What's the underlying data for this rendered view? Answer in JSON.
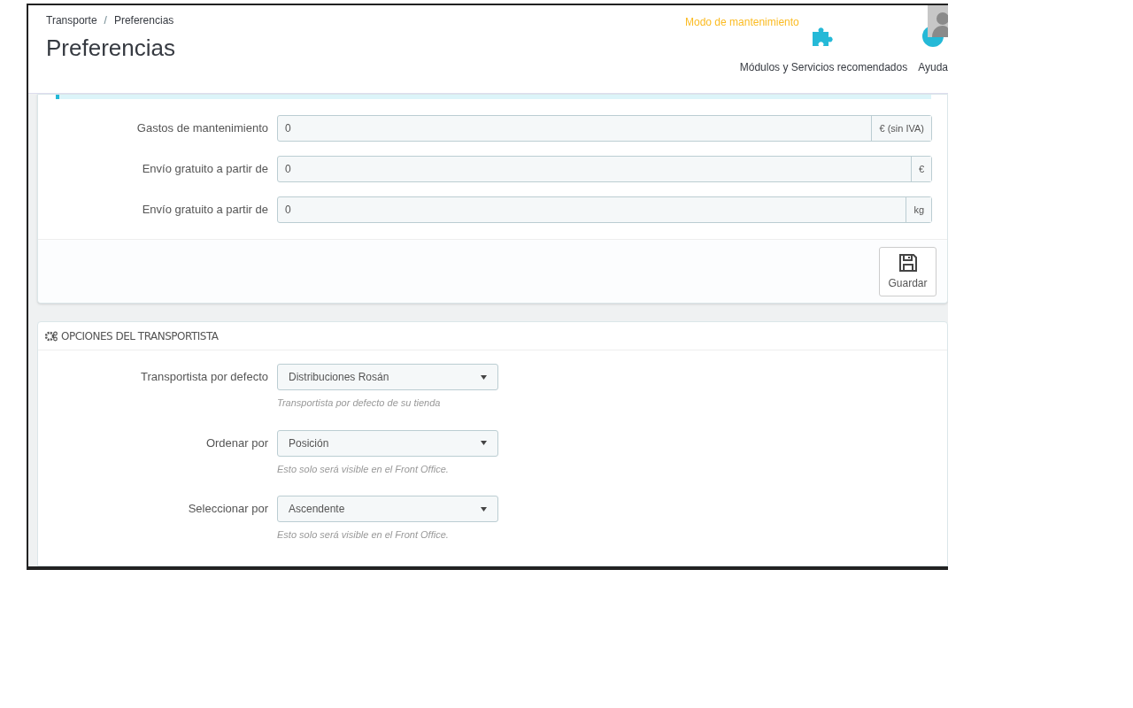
{
  "breadcrumb": [
    "Transporte",
    "Preferencias"
  ],
  "breadcrumb_separator": "/",
  "page_title": "Preferencias",
  "maintenance_link": "Modo de mantenimiento",
  "toolbar": [
    {
      "kind": "modules",
      "label": "Módulos y Servicios recomendados"
    },
    {
      "kind": "help",
      "label": "Ayuda"
    }
  ],
  "fees_panel": {
    "fields": [
      {
        "label": "Gastos de mantenimiento",
        "value": "0",
        "suffix": "€ (sin IVA)"
      },
      {
        "label": "Envío gratuito a partir de",
        "value": "0",
        "suffix": "€"
      },
      {
        "label": "Envío gratuito a partir de",
        "value": "0",
        "suffix": "kg"
      }
    ],
    "save_button": "Guardar"
  },
  "carrier_panel": {
    "title": "OPCIONES DEL TRANSPORTISTA",
    "fields": [
      {
        "label": "Transportista por defecto",
        "value": "Distribuciones Rosán",
        "help": "Transportista por defecto de su tienda"
      },
      {
        "label": "Ordenar por",
        "value": "Posición",
        "help": "Esto solo será visible en el Front Office."
      },
      {
        "label": "Seleccionar por",
        "value": "Ascendente",
        "help": "Esto solo será visible en el Front Office."
      }
    ]
  }
}
